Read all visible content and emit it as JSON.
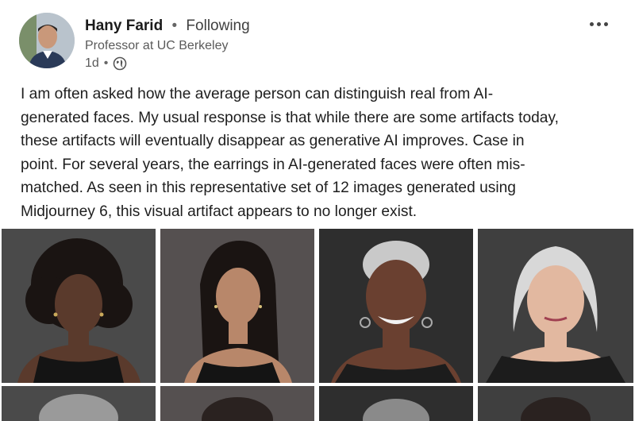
{
  "author": {
    "name": "Hany Farid",
    "separator": "•",
    "follow_status": "Following",
    "headline": "Professor at UC Berkeley",
    "time": "1d",
    "time_separator": "•",
    "visibility_icon": "globe-icon",
    "avatar_icon": "profile-photo"
  },
  "menu": {
    "more_icon": "more-dots-icon"
  },
  "post": {
    "lines": [
      "I am often asked how the average person can distinguish real from AI-",
      "generated faces. My usual response is that while there are some artifacts today,",
      "these artifacts will eventually disappear as generative AI improves. Case in",
      "point. For several years, the earrings in AI-generated faces were often mis-",
      "matched. As seen in this representative set of 12 images generated using",
      "Midjourney 6, this visual artifact appears to no longer exist."
    ]
  },
  "gallery": {
    "image_count_visible": 8,
    "colors": {
      "background_dark": "#3a3a3a",
      "skin_dark": "#5a3a2c",
      "skin_medium": "#b8876a",
      "hair_black": "#1a1412",
      "hair_gray": "#c9c9c9"
    }
  }
}
